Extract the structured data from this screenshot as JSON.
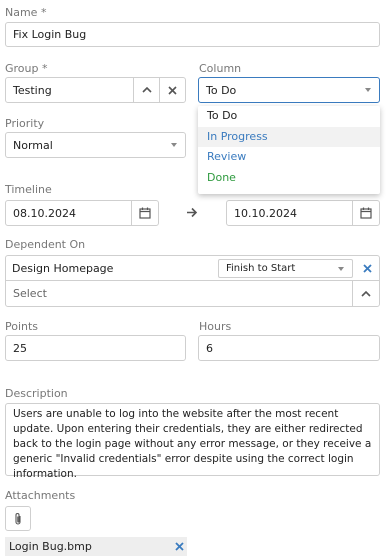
{
  "name": {
    "label": "Name *",
    "value": "Fix Login Bug"
  },
  "group": {
    "label": "Group *",
    "value": "Testing"
  },
  "column": {
    "label": "Column",
    "value": "To Do",
    "options": [
      {
        "label": "To Do",
        "color": "#222222"
      },
      {
        "label": "In Progress",
        "color": "#3a7bbf"
      },
      {
        "label": "Review",
        "color": "#3a7bbf"
      },
      {
        "label": "Done",
        "color": "#2e9a3e"
      }
    ]
  },
  "priority": {
    "label": "Priority",
    "value": "Normal"
  },
  "timeline": {
    "label": "Timeline",
    "start": "08.10.2024",
    "end": "10.10.2024"
  },
  "dependent_on": {
    "label": "Dependent On",
    "item": "Design Homepage",
    "relation": "Finish to Start",
    "select_placeholder": "Select"
  },
  "points": {
    "label": "Points",
    "value": "25"
  },
  "hours": {
    "label": "Hours",
    "value": "6"
  },
  "description": {
    "label": "Description",
    "value": "Users are unable to log into the website after the most recent update. Upon entering their credentials, they are either redirected back to the login page without any error message, or they receive a generic \"Invalid credentials\" error despite using the correct login information."
  },
  "attachments": {
    "label": "Attachments",
    "file": "Login Bug.bmp"
  },
  "colors": {
    "accent": "#3a7bbf",
    "remove_x": "#3a7bbf",
    "done": "#2e9a3e",
    "hover_row": "#f2f2f2"
  }
}
